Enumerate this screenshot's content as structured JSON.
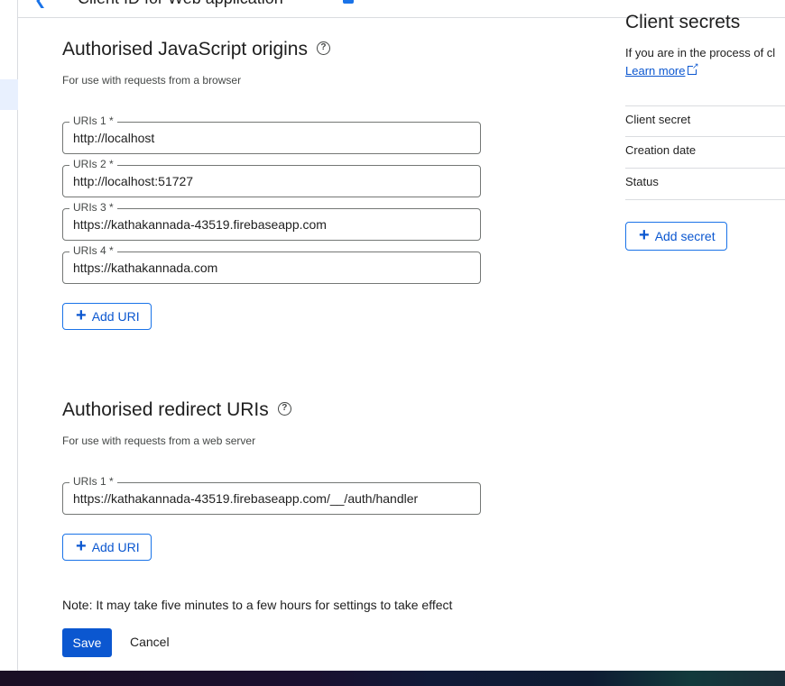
{
  "header": {
    "title": "Client ID for Web application"
  },
  "js_origins": {
    "title": "Authorised JavaScript origins",
    "subtitle": "For use with requests from a browser",
    "fields": [
      {
        "label": "URIs 1 *",
        "value": "http://localhost"
      },
      {
        "label": "URIs 2 *",
        "value": "http://localhost:51727"
      },
      {
        "label": "URIs 3 *",
        "value": "https://kathakannada-43519.firebaseapp.com"
      },
      {
        "label": "URIs 4 *",
        "value": "https://kathakannada.com"
      }
    ],
    "add_label": "Add URI"
  },
  "redirect_uris": {
    "title": "Authorised redirect URIs",
    "subtitle": "For use with requests from a web server",
    "fields": [
      {
        "label": "URIs 1 *",
        "value": "https://kathakannada-43519.firebaseapp.com/__/auth/handler"
      }
    ],
    "add_label": "Add URI"
  },
  "footer": {
    "note": "Note: It may take five minutes to a few hours for settings to take effect",
    "save_label": "Save",
    "cancel_label": "Cancel"
  },
  "client_secrets": {
    "title": "Client secrets",
    "description": "If you are in the process of cl",
    "learn_more": "Learn more",
    "rows": [
      "Client secret",
      "Creation date",
      "Status"
    ],
    "add_secret_label": "Add secret"
  },
  "colors": {
    "primary": "#0b57d0",
    "border": "#747775",
    "divider": "#dadce0"
  }
}
